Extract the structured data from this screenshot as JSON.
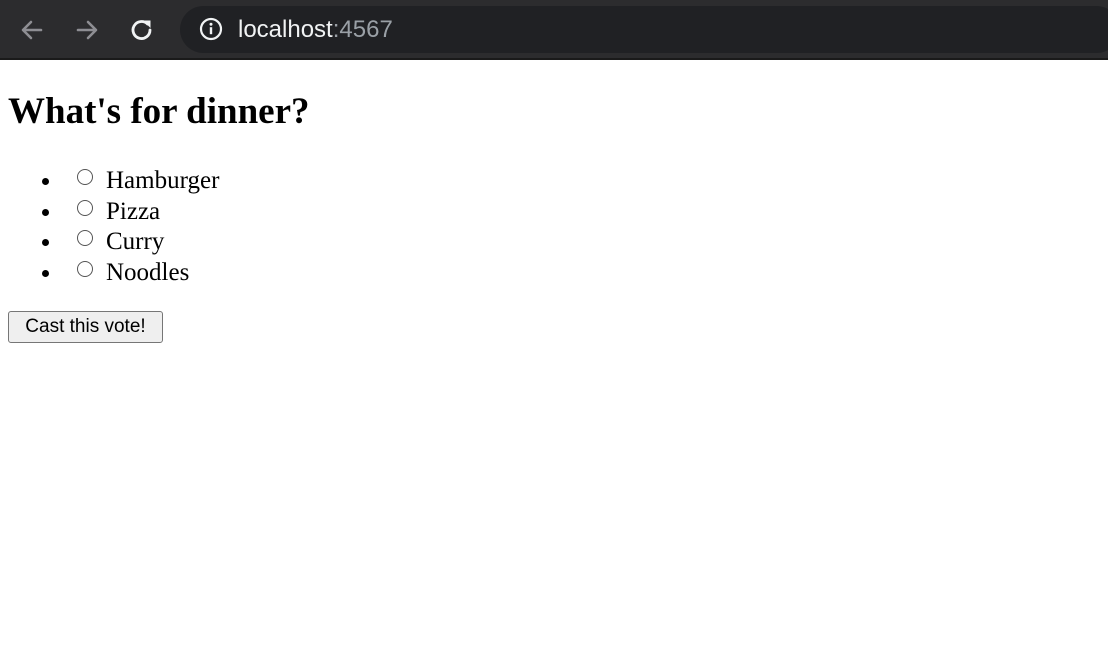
{
  "browser": {
    "url_host": "localhost",
    "url_port": ":4567",
    "icons": {
      "back": "arrow-left-icon",
      "forward": "arrow-right-icon",
      "reload": "reload-icon",
      "site_info": "info-icon"
    }
  },
  "page": {
    "title": "What's for dinner?",
    "options": [
      {
        "label": "Hamburger",
        "selected": false
      },
      {
        "label": "Pizza",
        "selected": false
      },
      {
        "label": "Curry",
        "selected": false
      },
      {
        "label": "Noodles",
        "selected": false
      }
    ],
    "submit_label": "Cast this vote!"
  },
  "colors": {
    "toolbar_bg": "#2c2c2e",
    "address_bg": "#202124",
    "url_host": "#f1f3f4",
    "url_port": "#9aa0a6"
  }
}
